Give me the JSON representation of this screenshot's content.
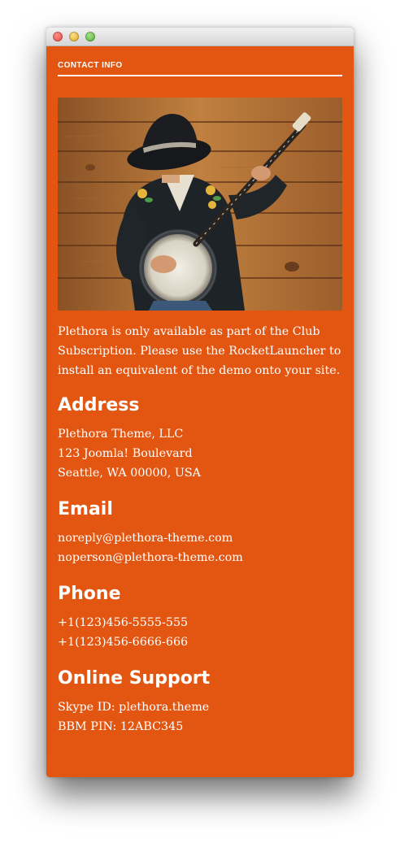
{
  "widget": {
    "title": "CONTACT INFO",
    "intro": "Plethora is only available as part of the Club Subscription. Please use the RocketLauncher to install an equivalent of the demo onto your site.",
    "image_alt": "Man in black hat playing banjo against wooden wall"
  },
  "address": {
    "heading": "Address",
    "lines": [
      "Plethora Theme, LLC",
      "123 Joomla! Boulevard",
      "Seattle, WA 00000, USA"
    ]
  },
  "email": {
    "heading": "Email",
    "lines": [
      "noreply@plethora-theme.com",
      "noperson@plethora-theme.com"
    ]
  },
  "phone": {
    "heading": "Phone",
    "lines": [
      "+1(123)456-5555-555",
      "+1(123)456-6666-666"
    ]
  },
  "support": {
    "heading": "Online Support",
    "lines": [
      "Skype ID: plethora.theme",
      "BBM PIN: 12ABC345"
    ]
  },
  "colors": {
    "background": "#e35612",
    "text": "#ffffff"
  }
}
